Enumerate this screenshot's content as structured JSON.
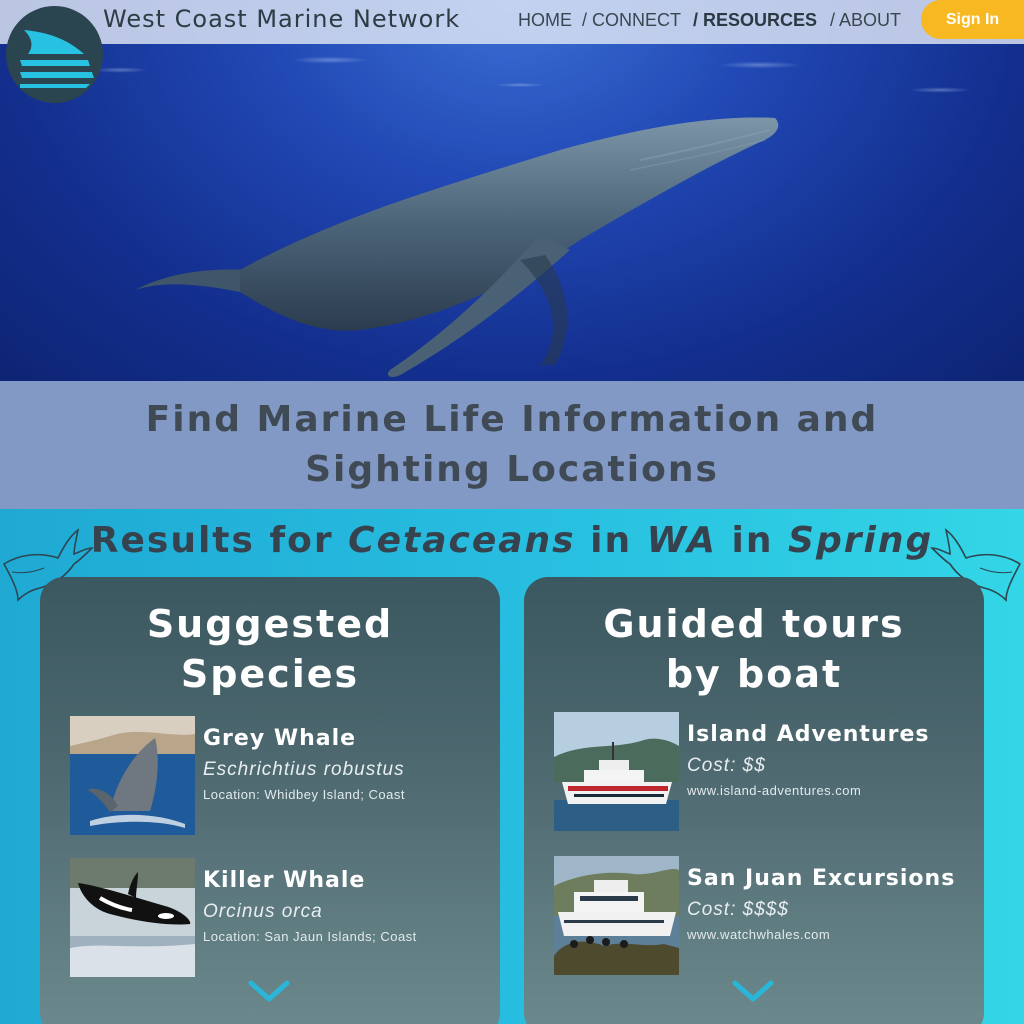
{
  "brand": {
    "name": "West Coast Marine Network"
  },
  "nav": {
    "items": [
      "HOME",
      "/ CONNECT",
      "/ RESOURCES",
      "/ ABOUT"
    ],
    "active": "RESOURCES",
    "signin_label": "Sign In"
  },
  "hero": {
    "headline_line1": "Find Marine Life Information and",
    "headline_line2": "Sighting Locations"
  },
  "results": {
    "prefix": "Results for",
    "group": "Cetaceans",
    "in1": "in",
    "region": "WA",
    "in2": "in",
    "season": "Spring"
  },
  "species_panel": {
    "title_line1": "Suggested",
    "title_line2": "Species",
    "items": [
      {
        "name": "Grey Whale",
        "scientific": "Eschrichtius robustus",
        "location": "Location: Whidbey Island; Coast"
      },
      {
        "name": "Killer Whale",
        "scientific": "Orcinus orca",
        "location": "Location: San Jaun Islands; Coast"
      }
    ]
  },
  "tours_panel": {
    "title_line1": "Guided tours",
    "title_line2": "by boat",
    "items": [
      {
        "name": "Island Adventures",
        "cost": "Cost: $$",
        "url": "www.island-adventures.com"
      },
      {
        "name": "San Juan Excursions",
        "cost": "Cost: $$$$",
        "url": "www.watchwhales.com"
      }
    ]
  },
  "icons": {
    "logo": "sail-logo-icon",
    "expand": "chevron-down-icon",
    "decoration": "whale-outline-icon"
  },
  "colors": {
    "accent": "#f8b821",
    "chevron": "#2ab6d8",
    "panel_top": "#3b575f",
    "headline_band": "#8299c6"
  }
}
